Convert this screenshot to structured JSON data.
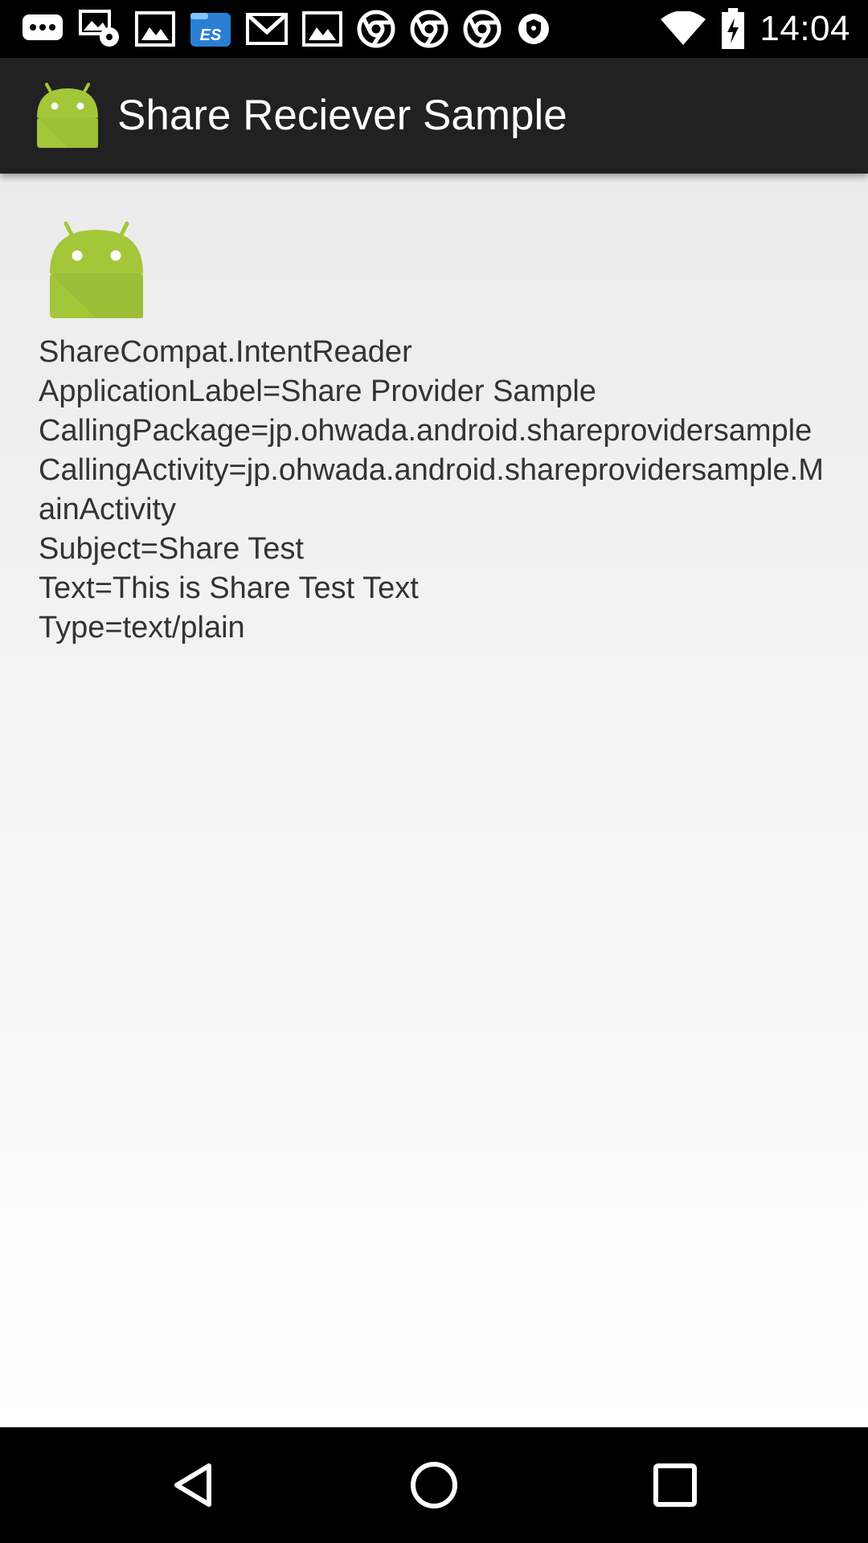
{
  "status_bar": {
    "time": "14:04",
    "left_icons": [
      "chat-bubble-icon",
      "gallery-settings-icon",
      "gallery-icon",
      "es-file-explorer-icon",
      "gmail-icon",
      "gallery-icon",
      "chrome-icon",
      "chrome-icon",
      "chrome-icon",
      "shield-icon"
    ],
    "right_icons": [
      "wifi-icon",
      "battery-icon"
    ]
  },
  "action_bar": {
    "title": "Share Reciever Sample",
    "icon": "android-icon",
    "icon_color": "#a4c639"
  },
  "content": {
    "image_icon": "android-icon",
    "lines": [
      "ShareCompat.IntentReader",
      "ApplicationLabel=Share Provider Sample",
      "CallingPackage=jp.ohwada.android.shareprovidersample",
      "CallingActivity=jp.ohwada.android.shareprovidersample.MainActivity",
      "Subject=Share Test",
      "Text=This is Share Test Text",
      "Type=text/plain"
    ]
  },
  "nav_bar": {
    "buttons": [
      "back-icon",
      "home-icon",
      "recents-icon"
    ]
  }
}
